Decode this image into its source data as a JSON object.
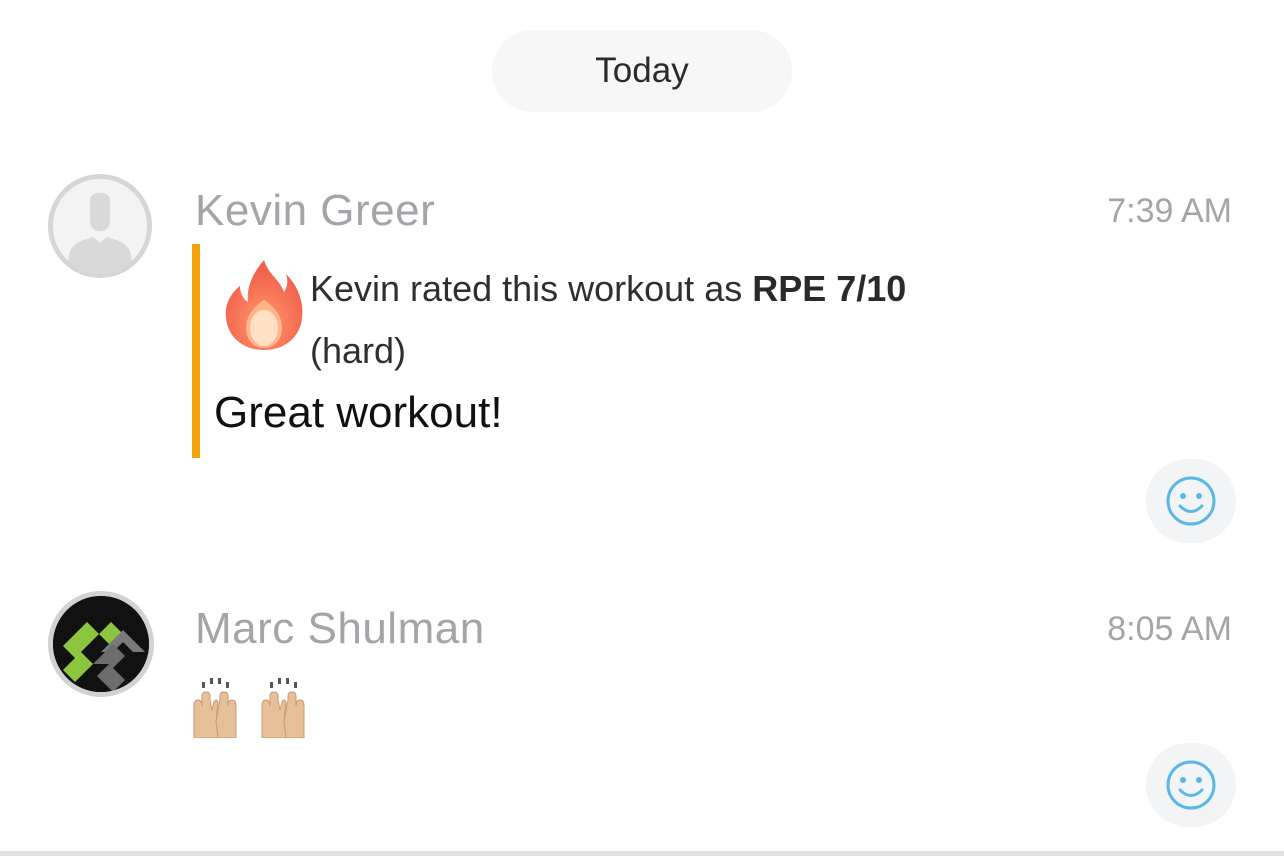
{
  "divider": {
    "date_label": "Today"
  },
  "messages": [
    {
      "sender": "Kevin Greer",
      "time": "7:39 AM",
      "rating": {
        "icon": "fire-icon",
        "text_prefix": "Kevin rated this workout as ",
        "score": "RPE 7/10",
        "difficulty": "(hard)"
      },
      "text": "Great workout!",
      "accent_color": "#f5a30c"
    },
    {
      "sender": "Marc Shulman",
      "time": "8:05 AM",
      "content_icon": "raised-hands-icon"
    }
  ],
  "colors": {
    "name_gray": "#a3a5a9",
    "react_icon_blue": "#5bb7e6"
  }
}
